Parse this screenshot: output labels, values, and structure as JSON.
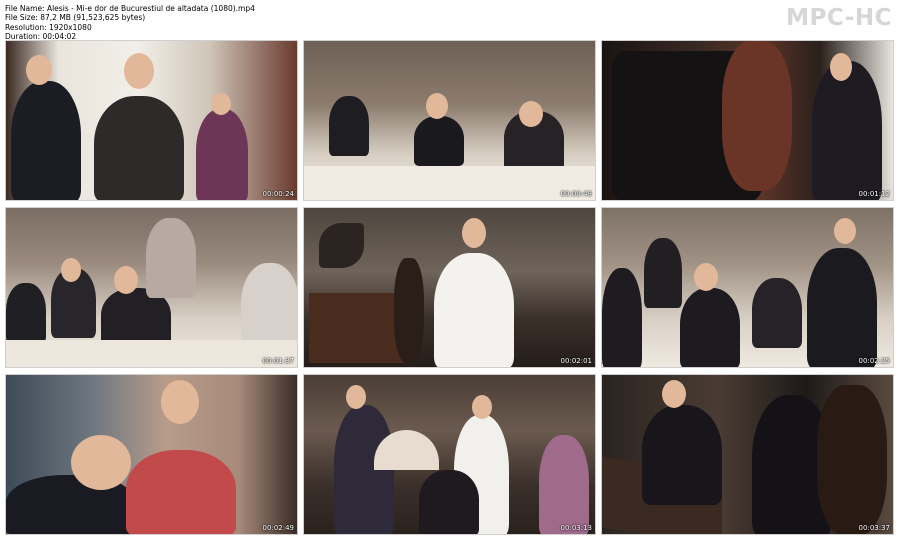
{
  "file_info": {
    "file_name": "File Name: Alesis - Mi-e dor de  Bucurestiul de altadata (1080).mp4",
    "file_size": "File Size: 87,2 MB (91,523,625 bytes)",
    "resolution": "Resolution: 1920x1080",
    "duration": "Duration: 00:04:02"
  },
  "logo": "MPC-HC",
  "thumbnails": [
    {
      "timestamp": "00:00:24"
    },
    {
      "timestamp": "00:00:48"
    },
    {
      "timestamp": "00:01:12"
    },
    {
      "timestamp": "00:01:37"
    },
    {
      "timestamp": "00:02:01"
    },
    {
      "timestamp": "00:02:25"
    },
    {
      "timestamp": "00:02:49"
    },
    {
      "timestamp": "00:03:13"
    },
    {
      "timestamp": "00:03:37"
    }
  ]
}
